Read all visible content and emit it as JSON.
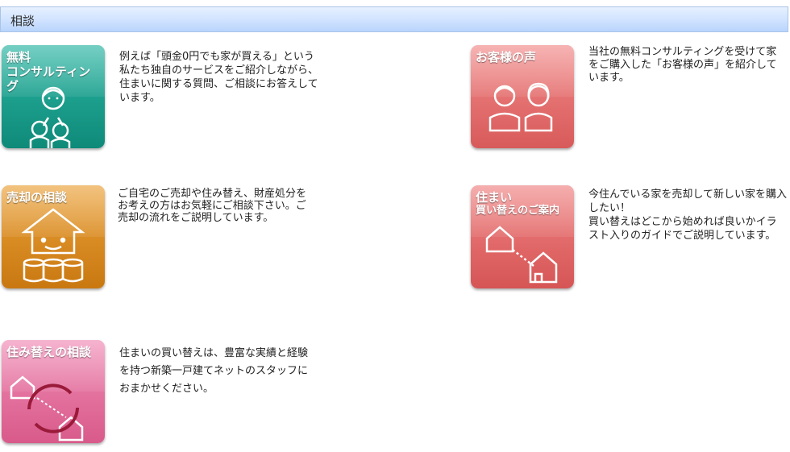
{
  "header": {
    "title": "相談"
  },
  "items": [
    {
      "tile_label_1": "無料",
      "tile_label_2": "コンサルティング",
      "color": "#1a9a8a",
      "description": "例えば「頭金0円でも家が買える」という私たち独自のサービスをご紹介しながら、住まいに関する質問、ご相談にお答えしています。"
    },
    {
      "tile_label_1": "お客様の声",
      "color": "#e36d6d",
      "description": "当社の無料コンサルティングを受けて家をご購入した「お客様の声」を紹介しています。"
    },
    {
      "tile_label_1": "売却の相談",
      "color": "#d98a1e",
      "description": "ご自宅のご売却や住み替え、財産処分をお考えの方はお気軽にご相談下さい。ご売却の流れをご説明しています。"
    },
    {
      "tile_label_1": "住まい",
      "tile_label_2": "買い替えのご案内",
      "color": "#e36d6d",
      "description_1": "今住んでいる家を売却して新しい家を購入したい！",
      "description_2": "買い替えはどこから始めれば良いかイラスト入りのガイドでご説明しています。"
    },
    {
      "tile_label_1": "住み替えの相談",
      "color": "#e0719d",
      "description": "住まいの買い替えは、豊富な実績と経験を持つ新築一戸建てネットのスタッフにおまかせください。"
    }
  ]
}
